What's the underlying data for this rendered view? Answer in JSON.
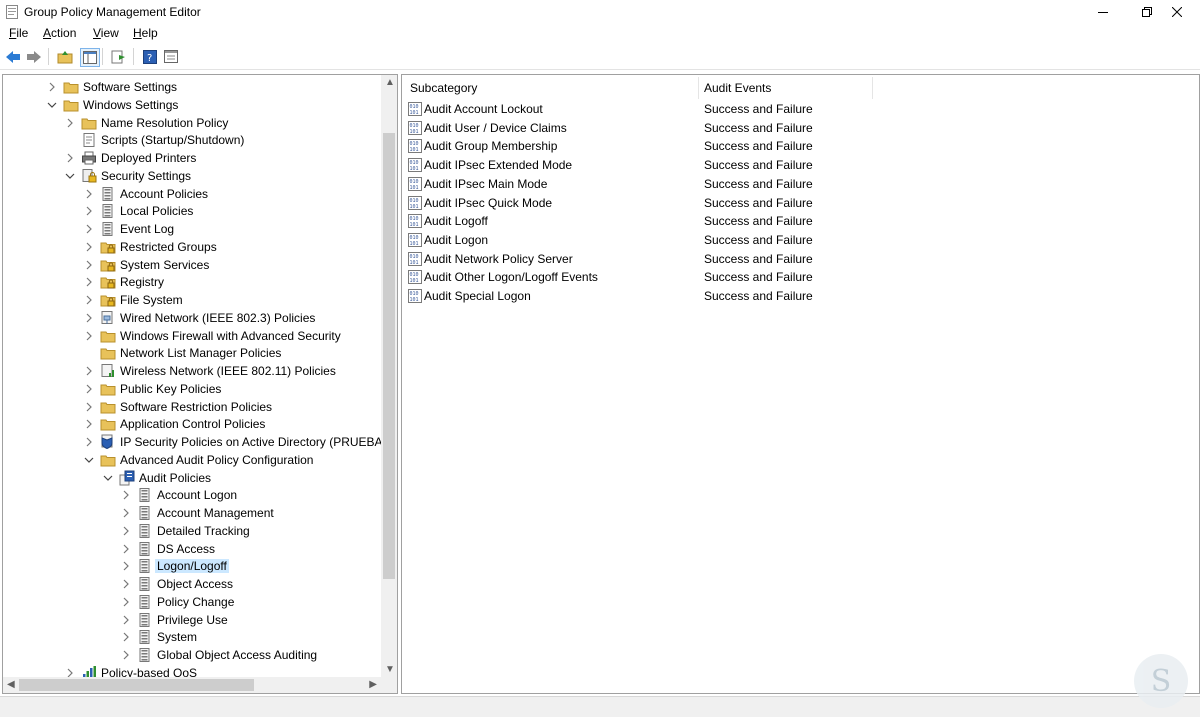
{
  "window": {
    "title": "Group Policy Management Editor"
  },
  "menu": [
    {
      "label": "File",
      "accel": "F",
      "rest": "ile"
    },
    {
      "label": "Action",
      "accel": "A",
      "rest": "ction"
    },
    {
      "label": "View",
      "accel": "V",
      "rest": "iew"
    },
    {
      "label": "Help",
      "accel": "H",
      "rest": "elp"
    }
  ],
  "toolbar": [
    "back-icon",
    "forward-icon",
    "up-folder-icon",
    "show-hide-tree-icon",
    "export-list-icon",
    "help-icon",
    "properties-icon"
  ],
  "tree": [
    {
      "label": "Software Settings",
      "level": 0,
      "expander": "collapsed",
      "icon": "folder"
    },
    {
      "label": "Windows Settings",
      "level": 0,
      "expander": "expanded",
      "icon": "folder"
    },
    {
      "label": "Name Resolution Policy",
      "level": 1,
      "expander": "collapsed",
      "icon": "folder"
    },
    {
      "label": "Scripts (Startup/Shutdown)",
      "level": 1,
      "expander": "none",
      "icon": "script"
    },
    {
      "label": "Deployed Printers",
      "level": 1,
      "expander": "collapsed",
      "icon": "printer"
    },
    {
      "label": "Security Settings",
      "level": 1,
      "expander": "expanded",
      "icon": "security"
    },
    {
      "label": "Account Policies",
      "level": 2,
      "expander": "collapsed",
      "icon": "policy"
    },
    {
      "label": "Local Policies",
      "level": 2,
      "expander": "collapsed",
      "icon": "policy"
    },
    {
      "label": "Event Log",
      "level": 2,
      "expander": "collapsed",
      "icon": "policy"
    },
    {
      "label": "Restricted Groups",
      "level": 2,
      "expander": "collapsed",
      "icon": "lockfolder"
    },
    {
      "label": "System Services",
      "level": 2,
      "expander": "collapsed",
      "icon": "lockfolder"
    },
    {
      "label": "Registry",
      "level": 2,
      "expander": "collapsed",
      "icon": "lockfolder"
    },
    {
      "label": "File System",
      "level": 2,
      "expander": "collapsed",
      "icon": "lockfolder"
    },
    {
      "label": "Wired Network (IEEE 802.3) Policies",
      "level": 2,
      "expander": "collapsed",
      "icon": "network"
    },
    {
      "label": "Windows Firewall with Advanced Security",
      "level": 2,
      "expander": "collapsed",
      "icon": "folder"
    },
    {
      "label": "Network List Manager Policies",
      "level": 2,
      "expander": "none",
      "icon": "folder"
    },
    {
      "label": "Wireless Network (IEEE 802.11) Policies",
      "level": 2,
      "expander": "collapsed",
      "icon": "wireless"
    },
    {
      "label": "Public Key Policies",
      "level": 2,
      "expander": "collapsed",
      "icon": "folder"
    },
    {
      "label": "Software Restriction Policies",
      "level": 2,
      "expander": "collapsed",
      "icon": "folder"
    },
    {
      "label": "Application Control Policies",
      "level": 2,
      "expander": "collapsed",
      "icon": "folder"
    },
    {
      "label": "IP Security Policies on Active Directory (PRUEBAS.C",
      "level": 2,
      "expander": "collapsed",
      "icon": "ipsec"
    },
    {
      "label": "Advanced Audit Policy Configuration",
      "level": 2,
      "expander": "expanded",
      "icon": "folder"
    },
    {
      "label": "Audit Policies",
      "level": 3,
      "expander": "expanded",
      "icon": "auditroot"
    },
    {
      "label": "Account Logon",
      "level": 4,
      "expander": "collapsed",
      "icon": "policy"
    },
    {
      "label": "Account Management",
      "level": 4,
      "expander": "collapsed",
      "icon": "policy"
    },
    {
      "label": "Detailed Tracking",
      "level": 4,
      "expander": "collapsed",
      "icon": "policy"
    },
    {
      "label": "DS Access",
      "level": 4,
      "expander": "collapsed",
      "icon": "policy"
    },
    {
      "label": "Logon/Logoff",
      "level": 4,
      "expander": "collapsed",
      "icon": "policy",
      "selected": true
    },
    {
      "label": "Object Access",
      "level": 4,
      "expander": "collapsed",
      "icon": "policy"
    },
    {
      "label": "Policy Change",
      "level": 4,
      "expander": "collapsed",
      "icon": "policy"
    },
    {
      "label": "Privilege Use",
      "level": 4,
      "expander": "collapsed",
      "icon": "policy"
    },
    {
      "label": "System",
      "level": 4,
      "expander": "collapsed",
      "icon": "policy"
    },
    {
      "label": "Global Object Access Auditing",
      "level": 4,
      "expander": "collapsed",
      "icon": "policy"
    },
    {
      "label": "Policy-based QoS",
      "level": 1,
      "expander": "collapsed",
      "icon": "qos"
    }
  ],
  "list": {
    "columns": [
      "Subcategory",
      "Audit Events"
    ],
    "rows": [
      {
        "subcategory": "Audit Account Lockout",
        "events": "Success and Failure"
      },
      {
        "subcategory": "Audit User / Device Claims",
        "events": "Success and Failure"
      },
      {
        "subcategory": "Audit Group Membership",
        "events": "Success and Failure"
      },
      {
        "subcategory": "Audit IPsec Extended Mode",
        "events": "Success and Failure"
      },
      {
        "subcategory": "Audit IPsec Main Mode",
        "events": "Success and Failure"
      },
      {
        "subcategory": "Audit IPsec Quick Mode",
        "events": "Success and Failure"
      },
      {
        "subcategory": "Audit Logoff",
        "events": "Success and Failure"
      },
      {
        "subcategory": "Audit Logon",
        "events": "Success and Failure"
      },
      {
        "subcategory": "Audit Network Policy Server",
        "events": "Success and Failure"
      },
      {
        "subcategory": "Audit Other Logon/Logoff Events",
        "events": "Success and Failure"
      },
      {
        "subcategory": "Audit Special Logon",
        "events": "Success and Failure"
      }
    ]
  },
  "colors": {
    "selection": "#cce8ff",
    "folder": "#e8c25a",
    "toolbar_arrow": "#2b7bd4"
  }
}
